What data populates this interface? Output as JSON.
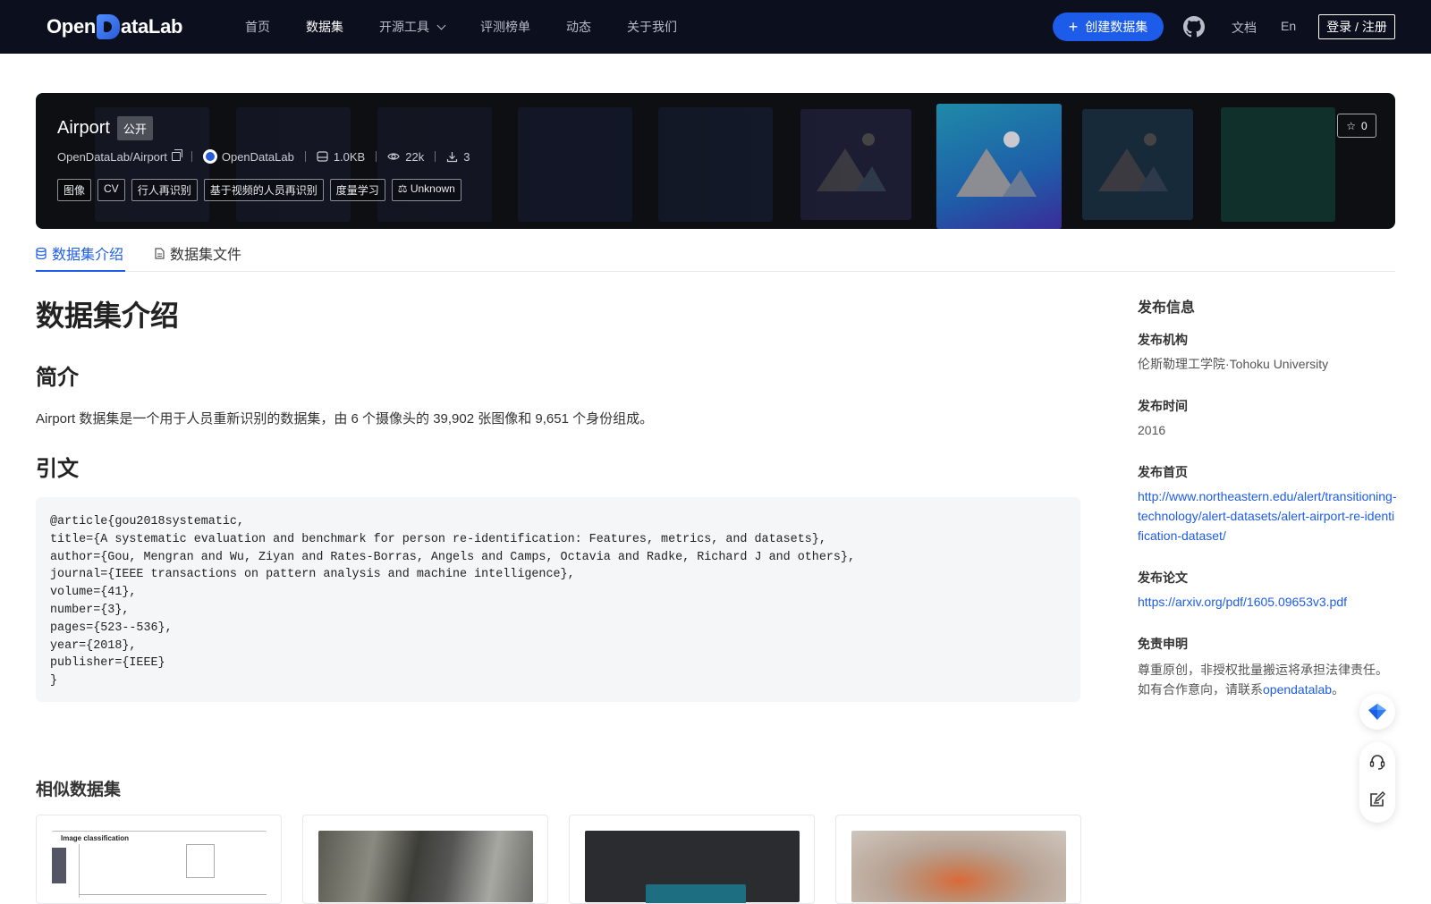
{
  "nav": {
    "logo_open": "Open",
    "logo_rest": "ataLab",
    "links": [
      "首页",
      "数据集",
      "开源工具",
      "评测榜单",
      "动态",
      "关于我们"
    ],
    "create_label": "创建数据集",
    "docs": "文档",
    "lang": "En",
    "login": "登录 / 注册"
  },
  "dataset": {
    "name": "Airport",
    "visibility": "公开",
    "path": "OpenDataLab/Airport",
    "org": "OpenDataLab",
    "size": "1.0KB",
    "views": "22k",
    "downloads": "3",
    "tags": [
      "图像",
      "CV",
      "行人再识别",
      "基于视频的人员再识别",
      "度量学习"
    ],
    "license": "Unknown",
    "stars": "0"
  },
  "tabs": {
    "intro": "数据集介绍",
    "files": "数据集文件"
  },
  "content": {
    "title": "数据集介绍",
    "summary_heading": "简介",
    "summary": "Airport 数据集是一个用于人员重新识别的数据集，由 6 个摄像头的 39,902 张图像和 9,651 个身份组成。",
    "citation_heading": "引文",
    "citation": "@article{gou2018systematic,\ntitle={A systematic evaluation and benchmark for person re-identification: Features, metrics, and datasets},\nauthor={Gou, Mengran and Wu, Ziyan and Rates-Borras, Angels and Camps, Octavia and Radke, Richard J and others},\njournal={IEEE transactions on pattern analysis and machine intelligence},\nvolume={41},\nnumber={3},\npages={523--536},\nyear={2018},\npublisher={IEEE}\n}",
    "similar_heading": "相似数据集"
  },
  "sidebar": {
    "title": "发布信息",
    "org_label": "发布机构",
    "org_value": "伦斯勒理工学院·Tohoku University",
    "time_label": "发布时间",
    "time_value": "2016",
    "home_label": "发布首页",
    "home_value": "http://www.northeastern.edu/alert/transitioning-technology/alert-datasets/alert-airport-re-identification-dataset/",
    "paper_label": "发布论文",
    "paper_value": "https://arxiv.org/pdf/1605.09653v3.pdf",
    "disclaimer_label": "免责申明",
    "disclaimer_line1": "尊重原创，非授权批量搬运将承担法律责任。",
    "disclaimer_line2_prefix": "如有合作意向，请联系",
    "disclaimer_link": "opendatalab",
    "disclaimer_suffix": "。"
  },
  "similar_cards": {
    "card1_text": "Image classification"
  },
  "colors": {
    "nav_bg": "#0b0f1e",
    "accent": "#1d5ce8",
    "banner_bg": "#0e0f13"
  }
}
